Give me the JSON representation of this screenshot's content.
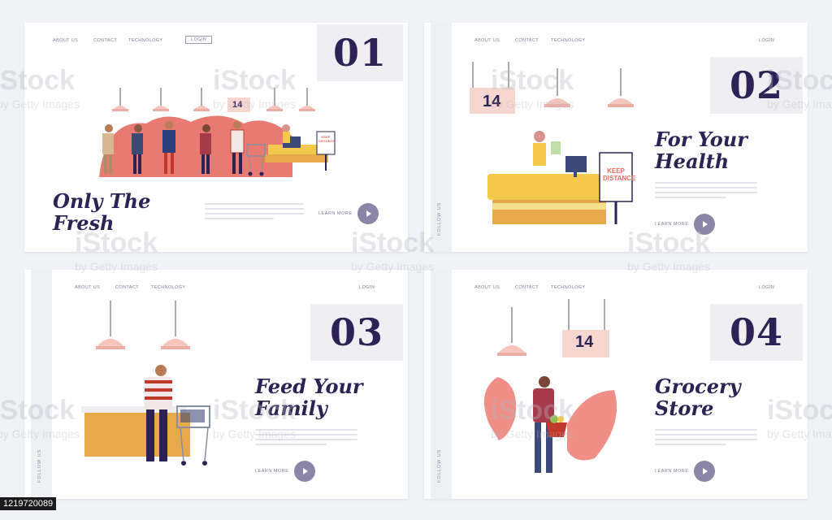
{
  "panels": [
    {
      "nav": [
        "ABOUT US",
        "CONTACT",
        "TECHNOLOGY"
      ],
      "login": "LOGIN",
      "number": "01",
      "title": "Only The\nFresh",
      "learn_more": "LEARN MORE",
      "sign_number": "14",
      "sign_text": "KEEP DISTANCE"
    },
    {
      "nav": [
        "ABOUT US",
        "CONTACT",
        "TECHNOLOGY"
      ],
      "login": "LOGIN",
      "number": "02",
      "title": "For Your\nHealth",
      "learn_more": "LEARN MORE",
      "side": "FOLLOW US",
      "sign_number": "14",
      "sign_text": "KEEP DISTANCE"
    },
    {
      "nav": [
        "ABOUT US",
        "CONTACT",
        "TECHNOLOGY"
      ],
      "login": "LOGIN",
      "number": "03",
      "title": "Feed Your\nFamily",
      "learn_more": "LEARN MORE",
      "side": "FOLLOW US"
    },
    {
      "nav": [
        "ABOUT US",
        "CONTACT",
        "TECHNOLOGY"
      ],
      "login": "LOGIN",
      "number": "04",
      "title": "Grocery\nStore",
      "learn_more": "LEARN MORE",
      "side": "FOLLOW US",
      "sign_number": "14"
    }
  ],
  "watermark": {
    "main": "iStock",
    "sub": "by Getty Images"
  },
  "image_id": "1219720089",
  "colors": {
    "navy": "#2c2256",
    "salmon": "#f08f85",
    "yellow": "#f3c94b",
    "play": "#8b86a8"
  }
}
